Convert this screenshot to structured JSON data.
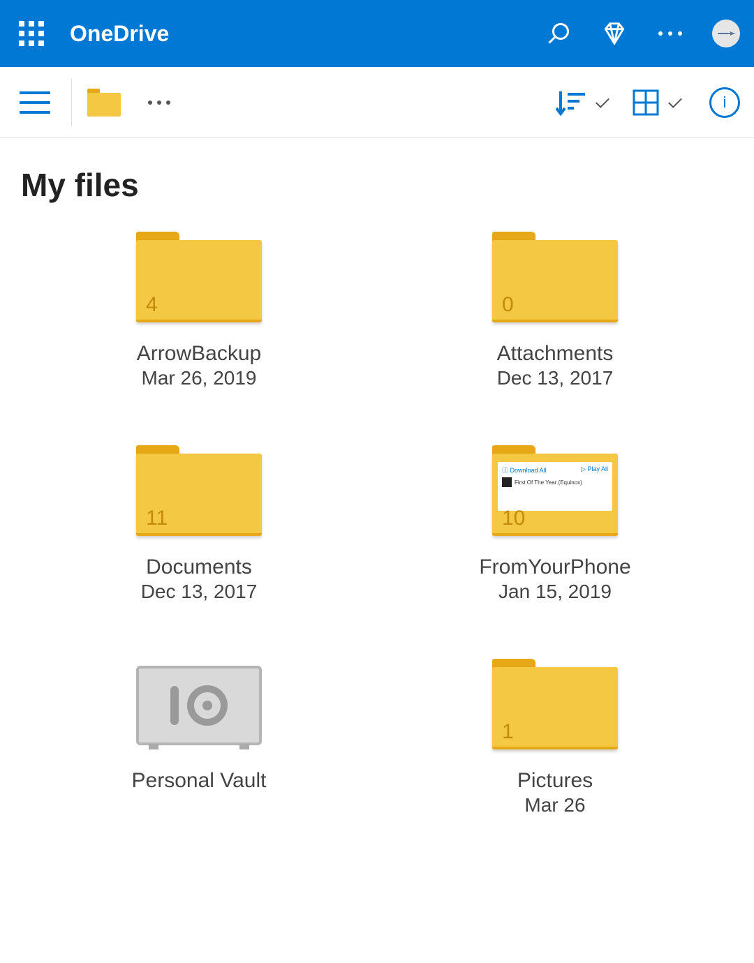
{
  "header": {
    "app_title": "OneDrive"
  },
  "toolbar": {},
  "page": {
    "title": "My files"
  },
  "items": [
    {
      "type": "folder",
      "name": "ArrowBackup",
      "date": "Mar 26, 2019",
      "count": "4",
      "preview": false
    },
    {
      "type": "folder",
      "name": "Attachments",
      "date": "Dec 13, 2017",
      "count": "0",
      "preview": false
    },
    {
      "type": "folder",
      "name": "Documents",
      "date": "Dec 13, 2017",
      "count": "11",
      "preview": false
    },
    {
      "type": "folder",
      "name": "FromYourPhone",
      "date": "Jan 15, 2019",
      "count": "10",
      "preview": true,
      "preview_labels": {
        "download": "Download All",
        "play": "Play All",
        "track": "First Of The Year (Equinox)"
      }
    },
    {
      "type": "vault",
      "name": "Personal Vault",
      "date": ""
    },
    {
      "type": "folder",
      "name": "Pictures",
      "date": "Mar 26",
      "count": "1",
      "preview": false
    }
  ]
}
